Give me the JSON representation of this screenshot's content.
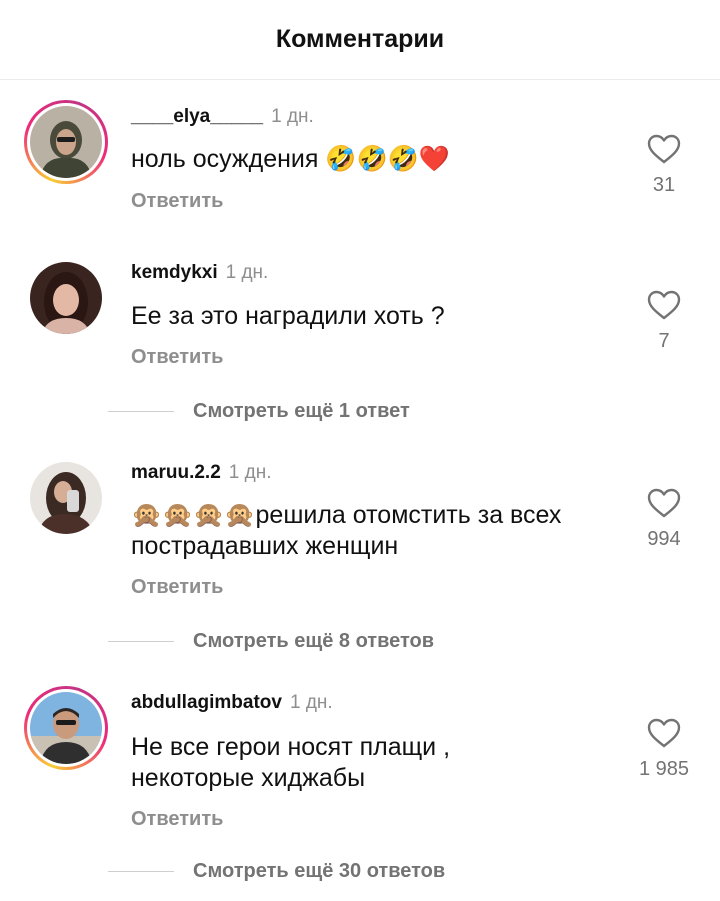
{
  "header": {
    "title": "Комментарии"
  },
  "reply_label": "Ответить",
  "comments": [
    {
      "username": "____elya_____",
      "time": "1 дн.",
      "text": "ноль осуждения 🤣🤣🤣❤️",
      "likes": "31",
      "has_story": true
    },
    {
      "username": "kemdykxi",
      "time": "1 дн.",
      "text": "Ее за это наградили хоть ?",
      "likes": "7",
      "has_story": false,
      "view_more": "Смотреть ещё 1 ответ"
    },
    {
      "username": "maruu.2.2",
      "time": "1 дн.",
      "text": "🙊🙊🙊🙊решила отомстить за всех пострадавших женщин",
      "likes": "994",
      "has_story": false,
      "view_more": "Смотреть ещё 8 ответов"
    },
    {
      "username": "abdullagimbatov",
      "time": "1 дн.",
      "text": "Не все герои носят плащи , некоторые хиджабы",
      "likes": "1 985",
      "has_story": true,
      "view_more": "Смотреть ещё 30 ответов"
    }
  ],
  "colors": {
    "muted": "#8e8e8e",
    "story_ring": "#ee2a7b",
    "like_count": "#737373"
  }
}
